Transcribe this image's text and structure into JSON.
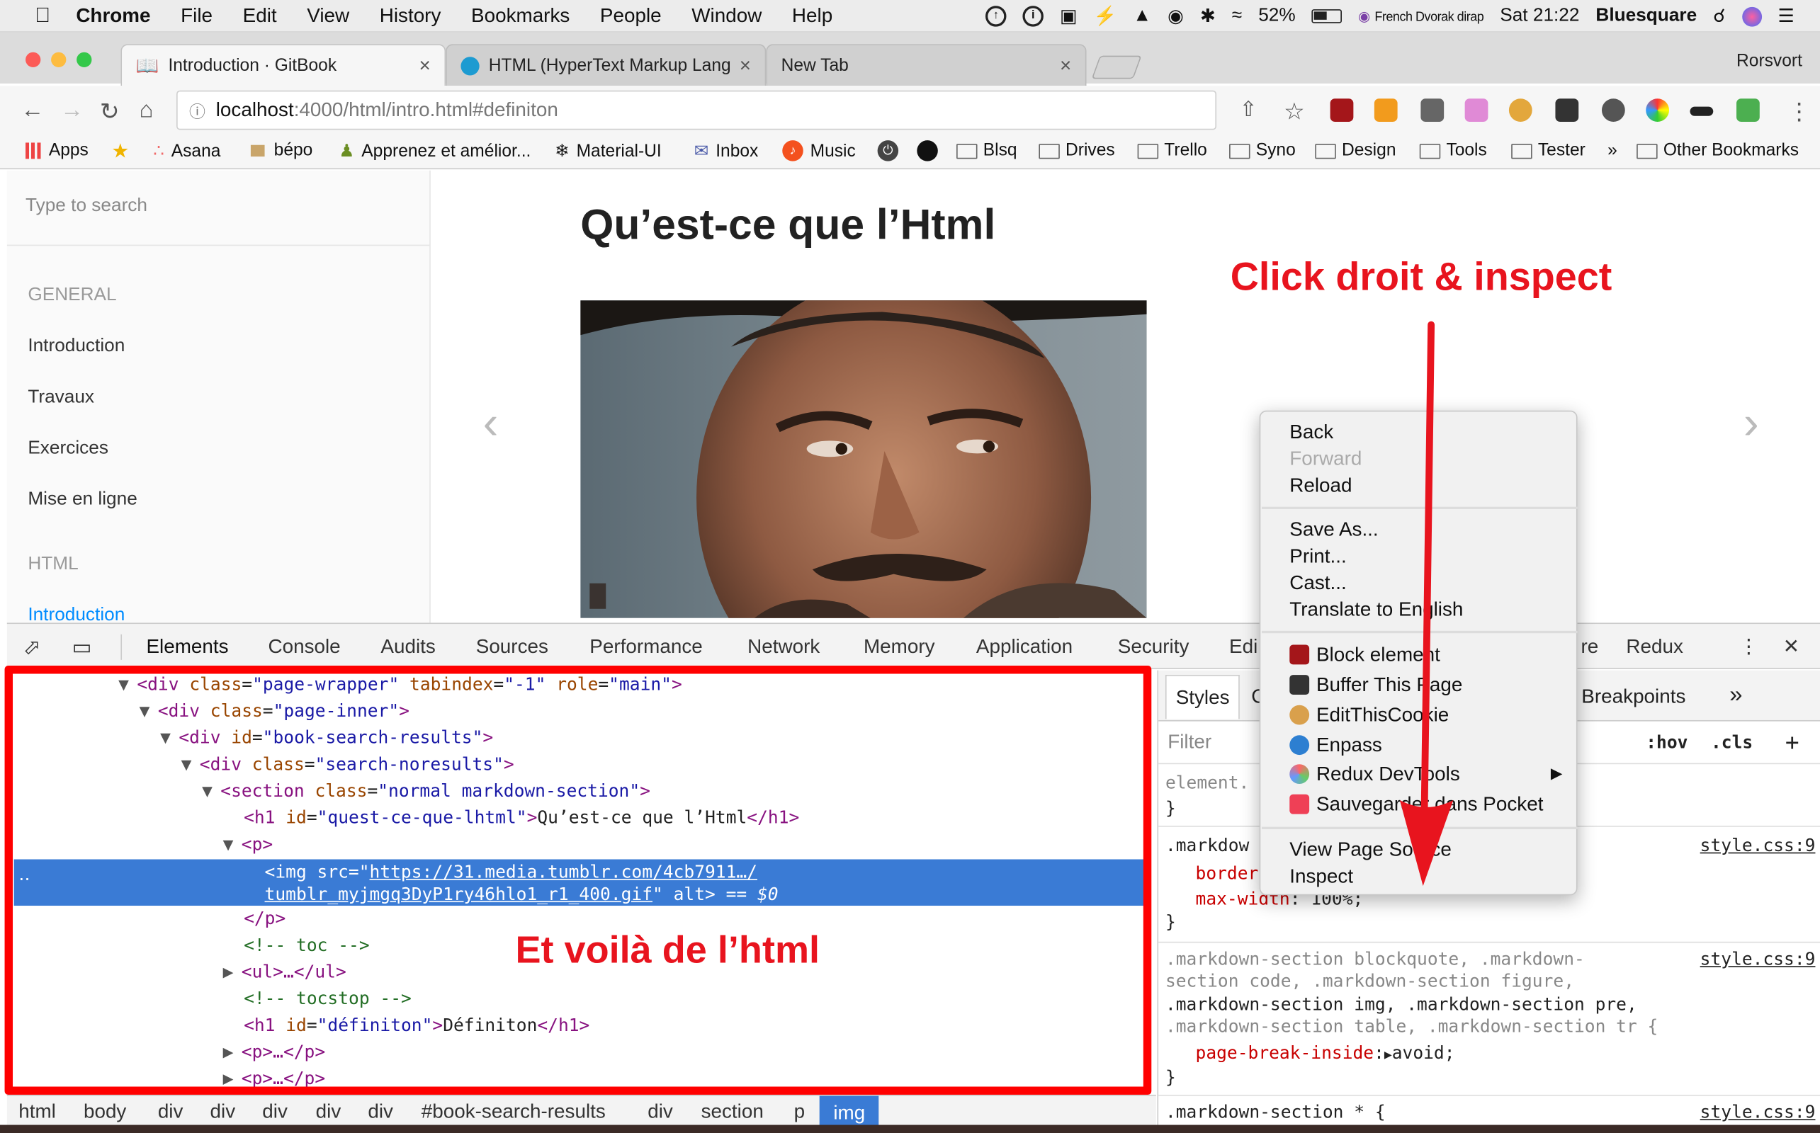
{
  "menubar": {
    "app": "Chrome",
    "items": [
      "File",
      "Edit",
      "View",
      "History",
      "Bookmarks",
      "People",
      "Window",
      "Help"
    ],
    "battery": "52%",
    "keyboard": "French Dvorak dirap",
    "clock": "Sat 21:22",
    "user": "Bluesquare"
  },
  "tabs": [
    {
      "title": "Introduction · GitBook",
      "close": "×"
    },
    {
      "title": "HTML (HyperText Markup Lang",
      "close": "×"
    },
    {
      "title": "New Tab",
      "close": "×"
    }
  ],
  "profile": "Rorsvort",
  "address": {
    "host": "localhost",
    "rest": ":4000/html/intro.html#definiton"
  },
  "bookmarks": [
    "Apps",
    "Asana",
    "bépo",
    "Apprenez et amélior...",
    "Material-UI",
    "Inbox",
    "Music",
    "Blsq",
    "Drives",
    "Trello",
    "Syno",
    "Design",
    "Tools",
    "Tester",
    "»",
    "Other Bookmarks"
  ],
  "sidebar": {
    "search_placeholder": "Type to search",
    "general_heading": "GENERAL",
    "items": [
      "Introduction",
      "Travaux",
      "Exercices",
      "Mise en ligne"
    ],
    "html_heading": "HTML",
    "html_items": [
      "Introduction"
    ]
  },
  "page": {
    "title": "Qu’est-ce que l’Html",
    "prev": "‹",
    "next": "›"
  },
  "annotations": {
    "top": "Click droit & inspect",
    "bottom": "Et voilà de l’html"
  },
  "devtools": {
    "tabs": [
      "Elements",
      "Console",
      "Audits",
      "Sources",
      "Performance",
      "Network",
      "Memory",
      "Application",
      "Security",
      "Edi",
      "re",
      "Redux"
    ],
    "close": "✕",
    "tree": [
      {
        "open": "<",
        "tag": "div",
        "attrs": [
          [
            "class",
            "page-wrapper"
          ],
          [
            "tabindex",
            "-1"
          ],
          [
            "role",
            "main"
          ]
        ],
        "close": ">"
      },
      {
        "open": "<",
        "tag": "div",
        "attrs": [
          [
            "class",
            "page-inner"
          ]
        ],
        "close": ">"
      },
      {
        "open": "<",
        "tag": "div",
        "attrs": [
          [
            "id",
            "book-search-results"
          ]
        ],
        "close": ">"
      },
      {
        "open": "<",
        "tag": "div",
        "attrs": [
          [
            "class",
            "search-noresults"
          ]
        ],
        "close": ">"
      },
      {
        "open": "<",
        "tag": "section",
        "attrs": [
          [
            "class",
            "normal markdown-section"
          ]
        ],
        "close": ">"
      }
    ],
    "h1_line": {
      "tag": "h1",
      "attr": "id",
      "value": "quest-ce-que-lhtml",
      "text": "Qu’est-ce que l’Html",
      "end": "</h1>"
    },
    "p_open": "<p>",
    "img_line1": {
      "tag": "img",
      "attr": "src",
      "url": "https://31.media.tumblr.com/4cb7911…/"
    },
    "img_line2": {
      "url": "tumblr_myjmgq3DyP1ry46hlo1_r1_400.gif",
      "attr": "alt",
      "marker": "== $0"
    },
    "p_close": "</p>",
    "toc": "<!-- toc -->",
    "ul": "<ul>…</ul>",
    "tocstop": "<!-- tocstop -->",
    "h1b": {
      "tag": "h1",
      "attr": "id",
      "value": "définiton",
      "text": "Définiton",
      "end": "</h1>"
    },
    "p_collapsed_1": "<p>…</p>",
    "p_collapsed_2": "<p>…</p>",
    "breadcrumbs": [
      "html",
      "body",
      "div",
      "div",
      "div",
      "div",
      "div",
      "#book-search-results",
      "div",
      "section",
      "p",
      "img"
    ],
    "styles": {
      "tab_styles": "Styles",
      "tab_c": "C",
      "tab_breakpoints": "l Breakpoints",
      "more": "»",
      "filter": "Filter",
      "hov": ":hov",
      "cls": ".cls",
      "plus": "+",
      "element": "element.",
      "brace_close": "}",
      "rule1_sel": ".markdow",
      "rule1_src": "style.css:9",
      "rule1_p1": "border",
      "rule1_p2": "max-width",
      "rule1_v2": "100%;",
      "rule2_sel_a": ".markdown-section blockquote, .markdown-",
      "rule2_sel_b": "section code, .markdown-section figure,",
      "rule2_sel_c": ".markdown-section img, .markdown-section pre,",
      "rule2_sel_d": ".markdown-section table, .markdown-section tr {",
      "rule2_src": "style.css:9",
      "rule2_prop": "page-break-inside",
      "rule2_val": "avoid;",
      "rule3_sel": ".markdown-section * {",
      "rule3_src": "style.css:9"
    }
  },
  "context_menu": {
    "back": "Back",
    "forward": "Forward",
    "reload": "Reload",
    "save_as": "Save As...",
    "print": "Print...",
    "cast": "Cast...",
    "translate": "Translate to English",
    "block": "Block element",
    "buffer": "Buffer This Page",
    "editcookie": "EditThisCookie",
    "enpass": "Enpass",
    "redux": "Redux DevTools",
    "submenu": "▶",
    "pocket": "Sauvegarder dans Pocket",
    "view_source": "View Page Source",
    "inspect": "Inspect"
  },
  "colors": {
    "annotation_red": "#e8141e",
    "selection_blue": "#3a7bd5",
    "box_red": "#ff0000"
  }
}
